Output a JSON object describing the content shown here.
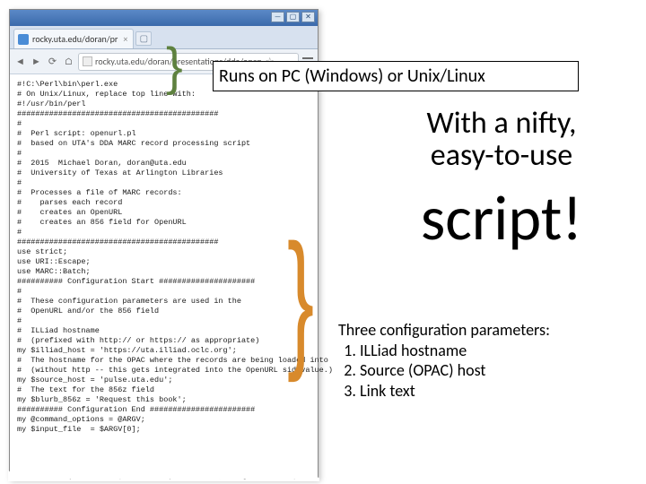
{
  "browser": {
    "tab_title": "rocky.uta.edu/doran/pr",
    "tab_close": "×",
    "new_tab": "▢",
    "nav": {
      "back": "◄",
      "fwd": "►",
      "reload": "⟳",
      "home": "⌂"
    },
    "url": "rocky.uta.edu/doran/presentations/dda/open",
    "star": "☆",
    "win": {
      "min": "—",
      "max": "▢",
      "close": "✕"
    }
  },
  "code": {
    "lines": [
      "#!C:\\Perl\\bin\\perl.exe",
      "",
      "# On Unix/Linux, replace top line with:",
      "#!/usr/bin/perl",
      "",
      "############################################",
      "#",
      "#  Perl script: openurl.pl",
      "#  based on UTA's DDA MARC record processing script",
      "#",
      "#  2015  Michael Doran, doran@uta.edu",
      "#  University of Texas at Arlington Libraries",
      "#",
      "#  Processes a file of MARC records:",
      "#    parses each record",
      "#    creates an OpenURL",
      "#    creates an 856 field for OpenURL",
      "#",
      "############################################",
      "",
      "use strict;",
      "",
      "use URI::Escape;",
      "",
      "use MARC::Batch;",
      "",
      "########## Configuration Start #####################",
      "#",
      "#  These configuration parameters are used in the",
      "#  OpenURL and/or the 856 field",
      "#",
      "#  ILLiad hostname",
      "#  (prefixed with http:// or https:// as appropriate)",
      "my $illiad_host = 'https://uta.illiad.oclc.org';",
      "",
      "#  The hostname for the OPAC where the records are being loaded into",
      "#  (without http -- this gets integrated into the OpenURL sid value.)",
      "my $source_host = 'pulse.uta.edu';",
      "",
      "#  The text for the 856z field",
      "my $blurb_856z = 'Request this book';",
      "",
      "########## Configuration End #######################",
      "",
      "my @command_options = @ARGV;",
      "",
      "my $input_file  = $ARGV[0];"
    ]
  },
  "annotations": {
    "runs_on": "Runs on PC (Windows) or Unix/Linux",
    "tagline_1": "With a nifty,",
    "tagline_2": "easy-to-use",
    "tagline_big": "script!",
    "params_head": "Three configuration parameters:",
    "params": [
      "ILLiad hostname",
      "Source (OPAC) host",
      "Link text"
    ]
  }
}
